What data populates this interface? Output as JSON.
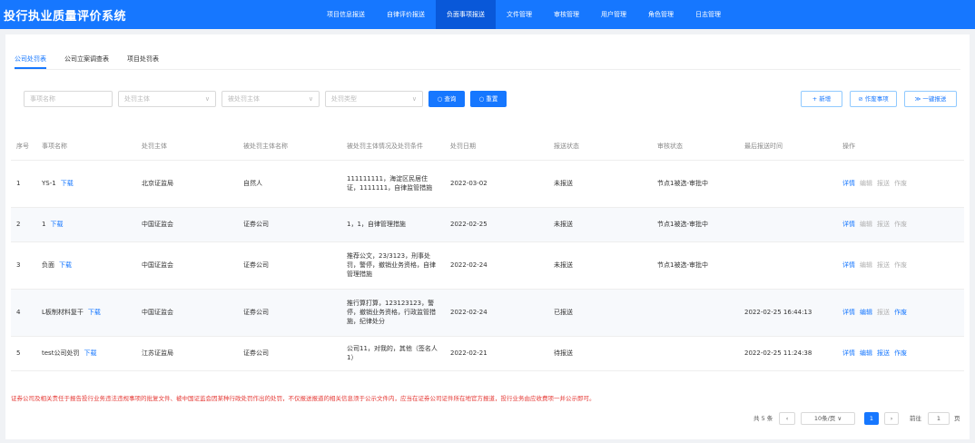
{
  "app_title": "投行执业质量评价系统",
  "nav": [
    "项目信息报送",
    "自律评价报送",
    "负面事项报送",
    "文件管理",
    "审核管理",
    "用户管理",
    "角色管理",
    "日志管理"
  ],
  "nav_active_index": 2,
  "tabs": [
    "公司处罚表",
    "公司立案调查表",
    "项目处罚表"
  ],
  "tab_active_index": 0,
  "filters": {
    "name_placeholder": "事项名称",
    "subject_placeholder": "处罚主体",
    "punished_placeholder": "被处罚主体",
    "type_placeholder": "处罚类型"
  },
  "buttons": {
    "search": "○ 查询",
    "reset": "○ 重置",
    "add": "+ 新增",
    "void_items": "⊘ 作废事项",
    "batch_submit": "≫ 一键报送"
  },
  "table": {
    "headers": [
      "序号",
      "事项名称",
      "处罚主体",
      "被处罚主体名称",
      "被处罚主体情况及处罚条件",
      "处罚日期",
      "报送状态",
      "审核状态",
      "最后报送时间",
      "操作"
    ],
    "download_label": "下载",
    "actions": [
      "详情",
      "编辑",
      "报送",
      "作废"
    ],
    "rows": [
      {
        "no": "1",
        "name": "YS-1",
        "subject": "北京证监局",
        "punished": "自然人",
        "detail": "111111111，海淀区民居住证，1111111，自律监管措施",
        "date": "2022-03-02",
        "submit_status": "未报送",
        "review_status": "节点1被选-审批中",
        "last_time": "",
        "enabled": [
          true,
          false,
          false,
          false
        ]
      },
      {
        "no": "2",
        "name": "1",
        "subject": "中国证监会",
        "punished": "证券公司",
        "detail": "1，1，自律管理措施",
        "date": "2022-02-25",
        "submit_status": "未报送",
        "review_status": "节点1被选-审批中",
        "last_time": "",
        "enabled": [
          true,
          false,
          false,
          false
        ]
      },
      {
        "no": "3",
        "name": "负面",
        "subject": "中国证监会",
        "punished": "证券公司",
        "detail": "推荐公文，23/3123，刑事处罚，警停，撤销业务资格，自律管理措施",
        "date": "2022-02-24",
        "submit_status": "未报送",
        "review_status": "节点1被选-审批中",
        "last_time": "",
        "enabled": [
          true,
          false,
          false,
          false
        ]
      },
      {
        "no": "4",
        "name": "L板制材料复干",
        "subject": "中国证监会",
        "punished": "证券公司",
        "detail": "推行算打算，123123123，警停，撤销业务资格，行政监管措施，纪律处分",
        "date": "2022-02-24",
        "submit_status": "已报送",
        "review_status": "",
        "last_time": "2022-02-25 16:44:13",
        "enabled": [
          true,
          true,
          false,
          true
        ]
      },
      {
        "no": "5",
        "name": "test公司处罚",
        "subject": "江苏证监局",
        "punished": "证券公司",
        "detail": "公司11，对我的，其他（签名人1）",
        "date": "2022-02-21",
        "submit_status": "待报送",
        "review_status": "",
        "last_time": "2022-02-25 11:24:38",
        "enabled": [
          true,
          true,
          true,
          true
        ]
      }
    ]
  },
  "notice": "证券公司及相关责任于报告投行业务违法违规事项的批复文件、被中国证监会因某种行政处罚作出的处罚，不仅报送报道的相关信息须于公示文件内，应当在证券公司证件所在地官方报道，投行业务由应收费项一并公示即可。",
  "pagination": {
    "total": "共 5 条",
    "page_size": "10条/页",
    "current": "1",
    "goto_label": "前往",
    "goto_value": "1",
    "page_unit": "页"
  },
  "colors": {
    "primary": "#1677ff",
    "notice": "#e53935"
  }
}
